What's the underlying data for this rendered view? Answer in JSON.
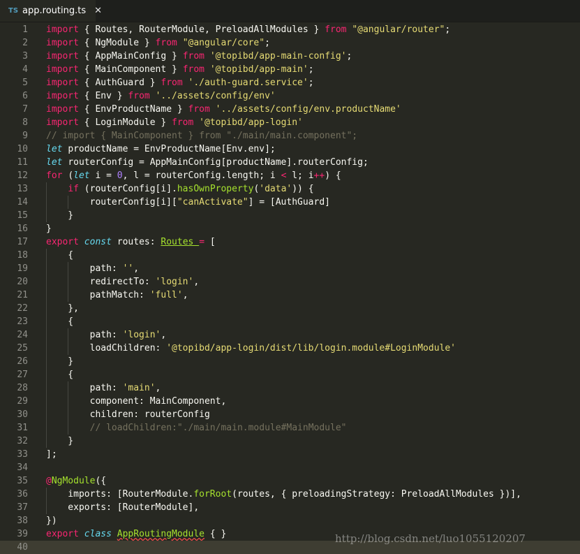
{
  "tab": {
    "lang_badge": "TS",
    "title": "app.routing.ts",
    "close_glyph": "✕",
    "icon": "typescript-file-icon"
  },
  "editor": {
    "current_line": 40,
    "lines": [
      [
        [
          "kw",
          "import"
        ],
        [
          "",
          "{ Routes, RouterModule, PreloadAllModules } "
        ],
        [
          "kw",
          "from"
        ],
        [
          "",
          ""
        ],
        [
          "st",
          "\"@angular/router\""
        ],
        [
          "",
          ";"
        ]
      ],
      [
        [
          "kw",
          "import"
        ],
        [
          "",
          "{ NgModule } "
        ],
        [
          "kw",
          "from"
        ],
        [
          "st",
          "\"@angular/core\""
        ],
        [
          "",
          ";"
        ]
      ],
      [
        [
          "kw",
          "import"
        ],
        [
          "",
          "{ AppMainConfig } "
        ],
        [
          "kw",
          "from"
        ],
        [
          "st",
          "'@topibd/app-main-config'"
        ],
        [
          "",
          ";"
        ]
      ],
      [
        [
          "kw",
          "import"
        ],
        [
          "",
          "{ MainComponent } "
        ],
        [
          "kw",
          "from"
        ],
        [
          "st",
          "'@topibd/app-main'"
        ],
        [
          "",
          ";"
        ]
      ],
      [
        [
          "kw",
          "import"
        ],
        [
          "",
          "{ AuthGuard } "
        ],
        [
          "kw",
          "from"
        ],
        [
          "st",
          "'./auth-guard.service'"
        ],
        [
          "",
          ";"
        ]
      ],
      [
        [
          "kw",
          "import"
        ],
        [
          "",
          "{ Env } "
        ],
        [
          "kw",
          "from"
        ],
        [
          "st",
          "'../assets/config/env'"
        ]
      ],
      [
        [
          "kw",
          "import"
        ],
        [
          "",
          "{ EnvProductName } "
        ],
        [
          "kw",
          "from"
        ],
        [
          "st",
          "'../assets/config/env.productName'"
        ]
      ],
      [
        [
          "kw",
          "import"
        ],
        [
          "",
          "{ LoginModule } "
        ],
        [
          "kw",
          "from"
        ],
        [
          "st",
          "'@topibd/app-login'"
        ]
      ],
      [
        [
          "cm",
          "// import { MainComponent } from \"./main/main.component\";"
        ]
      ],
      [
        [
          "st2",
          "let"
        ],
        [
          "",
          "productName = EnvProductName[Env.env];"
        ]
      ],
      [
        [
          "st2",
          "let"
        ],
        [
          "",
          "routerConfig = AppMainConfig[productName].routerConfig;"
        ]
      ],
      [
        [
          "kw",
          "for"
        ],
        [
          "",
          "("
        ],
        [
          "st2",
          "let"
        ],
        [
          "",
          "i = "
        ],
        [
          "num",
          "0"
        ],
        [
          "",
          ", l = routerConfig.length; i "
        ],
        [
          "kw",
          "<"
        ],
        [
          "",
          "l; i"
        ],
        [
          "kw",
          "++"
        ],
        [
          "",
          ") {"
        ]
      ],
      [
        [
          "",
          "    "
        ],
        [
          "kw",
          "if"
        ],
        [
          "",
          "(routerConfig[i]."
        ],
        [
          "fn",
          "hasOwnProperty"
        ],
        [
          "",
          "("
        ],
        [
          "st",
          "'data'"
        ],
        [
          "",
          ")) {"
        ]
      ],
      [
        [
          "",
          "        routerConfig[i]["
        ],
        [
          "st",
          "\"canActivate\""
        ],
        [
          "",
          "] = [AuthGuard]"
        ]
      ],
      [
        [
          "",
          "    }"
        ]
      ],
      [
        [
          "",
          "}"
        ]
      ],
      [
        [
          "kw",
          "export"
        ],
        [
          "st2",
          "const"
        ],
        [
          "",
          "routes: "
        ],
        [
          "ty",
          "Routes"
        ],
        [
          "",
          ""
        ],
        [
          "kw",
          "="
        ],
        [
          "",
          "["
        ]
      ],
      [
        [
          "",
          "    {"
        ]
      ],
      [
        [
          "",
          "        path: "
        ],
        [
          "st",
          "''"
        ],
        [
          "",
          ","
        ]
      ],
      [
        [
          "",
          "        redirectTo: "
        ],
        [
          "st",
          "'login'"
        ],
        [
          "",
          ","
        ]
      ],
      [
        [
          "",
          "        pathMatch: "
        ],
        [
          "st",
          "'full'"
        ],
        [
          "",
          ","
        ]
      ],
      [
        [
          "",
          "    },"
        ]
      ],
      [
        [
          "",
          "    {"
        ]
      ],
      [
        [
          "",
          "        path: "
        ],
        [
          "st",
          "'login'"
        ],
        [
          "",
          ","
        ]
      ],
      [
        [
          "",
          "        loadChildren: "
        ],
        [
          "st",
          "'@topibd/app-login/dist/lib/login.module#LoginModule'"
        ]
      ],
      [
        [
          "",
          "    }"
        ]
      ],
      [
        [
          "",
          "    {"
        ]
      ],
      [
        [
          "",
          "        path: "
        ],
        [
          "st",
          "'main'"
        ],
        [
          "",
          ","
        ]
      ],
      [
        [
          "",
          "        component: MainComponent,"
        ]
      ],
      [
        [
          "",
          "        children: routerConfig"
        ]
      ],
      [
        [
          "",
          "        "
        ],
        [
          "cm",
          "// loadChildren:\"./main/main.module#MainModule\""
        ]
      ],
      [
        [
          "",
          "    }"
        ]
      ],
      [
        [
          "",
          "];"
        ]
      ],
      [],
      [
        [
          "kw",
          "@"
        ],
        [
          "fn",
          "NgModule"
        ],
        [
          "",
          "({"
        ]
      ],
      [
        [
          "",
          "    imports: [RouterModule."
        ],
        [
          "fn",
          "forRoot"
        ],
        [
          "",
          "(routes, { preloadingStrategy: PreloadAllModules })],"
        ]
      ],
      [
        [
          "",
          "    exports: [RouterModule],"
        ]
      ],
      [
        [
          "",
          "})"
        ]
      ],
      [
        [
          "kw",
          "export"
        ],
        [
          "st2",
          "class"
        ],
        [
          "ty err",
          "AppRoutingModule"
        ],
        [
          "",
          "{ }"
        ]
      ],
      []
    ]
  },
  "watermark": "http://blog.csdn.net/luo1055120207"
}
